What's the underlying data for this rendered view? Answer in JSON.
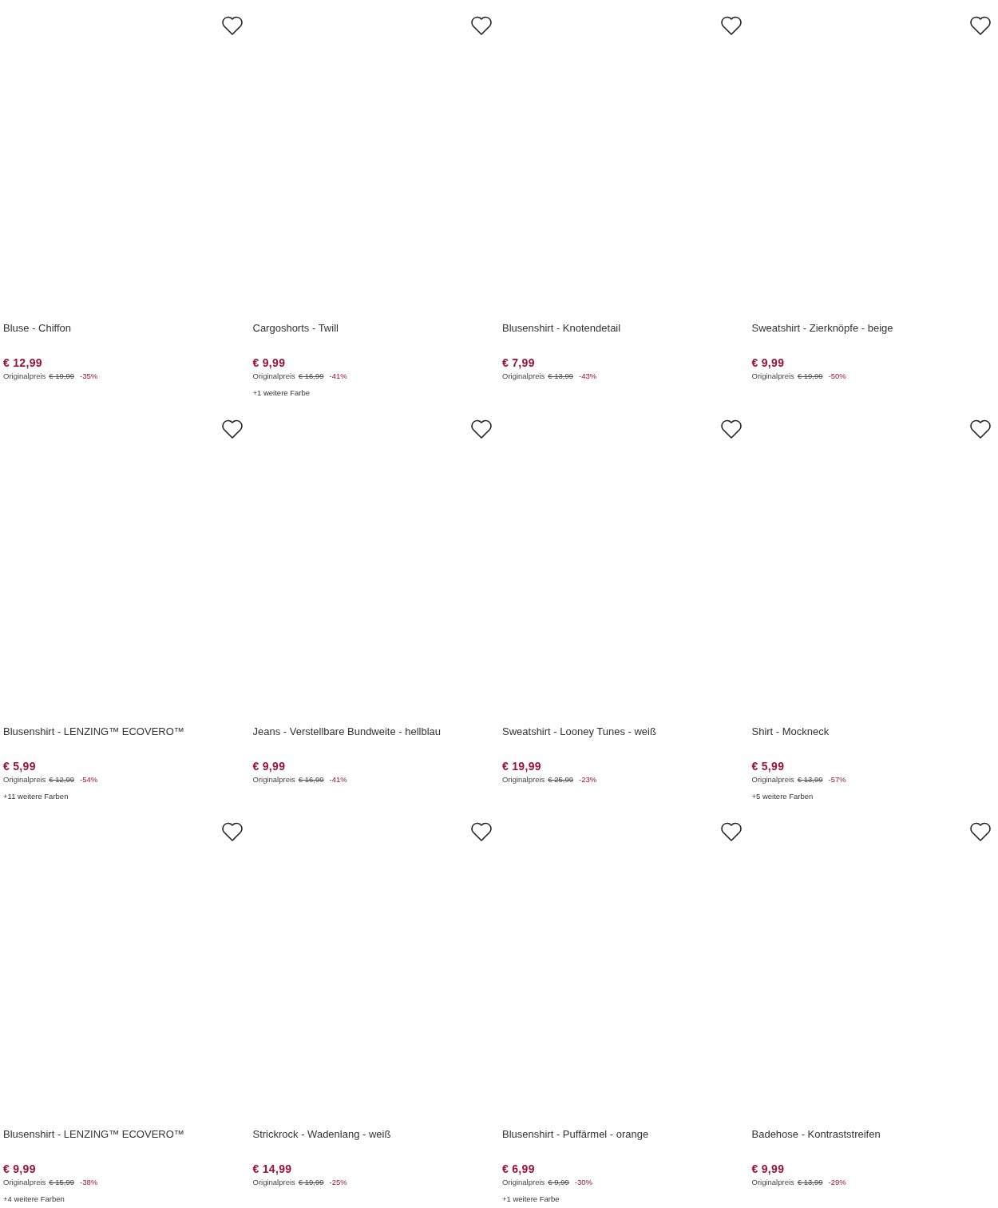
{
  "products": [
    {
      "title": "Bluse - Chiffon",
      "price": "€ 12,99",
      "original_label": "Originalpreis",
      "original_price": "€ 19,99",
      "discount": "-35%",
      "favorite": false
    },
    {
      "title": "Cargoshorts - Twill",
      "price": "€ 9,99",
      "original_label": "Originalpreis",
      "original_price": "€ 16,99",
      "discount": "-41%",
      "more_colors": "+1 weitere Farbe",
      "favorite": false
    },
    {
      "title": "Blusenshirt - Knotendetail",
      "price": "€ 7,99",
      "original_label": "Originalpreis",
      "original_price": "€ 13,99",
      "discount": "-43%",
      "favorite": false
    },
    {
      "title": "Sweatshirt - Zierknöpfe - beige",
      "price": "€ 9,99",
      "original_label": "Originalpreis",
      "original_price": "€ 19,99",
      "discount": "-50%",
      "favorite": false
    },
    {
      "title": "Blusenshirt - LENZING™ ECOVERO™",
      "price": "€ 5,99",
      "original_label": "Originalpreis",
      "original_price": "€ 12,99",
      "discount": "-54%",
      "more_colors": "+11 weitere Farben",
      "favorite": false
    },
    {
      "title": "Jeans - Verstellbare Bundweite - hellblau",
      "price": "€ 9,99",
      "original_label": "Originalpreis",
      "original_price": "€ 16,99",
      "discount": "-41%",
      "favorite": false
    },
    {
      "title": "Sweatshirt - Looney Tunes - weiß",
      "price": "€ 19,99",
      "original_label": "Originalpreis",
      "original_price": "€ 25,99",
      "discount": "-23%",
      "favorite": false
    },
    {
      "title": "Shirt - Mockneck",
      "price": "€ 5,99",
      "original_label": "Originalpreis",
      "original_price": "€ 13,99",
      "discount": "-57%",
      "more_colors": "+5 weitere Farben",
      "favorite": false
    },
    {
      "title": "Blusenshirt - LENZING™ ECOVERO™",
      "price": "€ 9,99",
      "original_label": "Originalpreis",
      "original_price": "€ 15,99",
      "discount": "-38%",
      "more_colors": "+4 weitere Farben",
      "favorite": false
    },
    {
      "title": "Strickrock - Wadenlang - weiß",
      "price": "€ 14,99",
      "original_label": "Originalpreis",
      "original_price": "€ 19,99",
      "discount": "-25%",
      "favorite": false
    },
    {
      "title": "Blusenshirt - Puffärmel - orange",
      "price": "€ 6,99",
      "original_label": "Originalpreis",
      "original_price": "€ 9,99",
      "discount": "-30%",
      "more_colors": "+1 weitere Farbe",
      "favorite": false
    },
    {
      "title": "Badehose - Kontraststreifen",
      "price": "€ 9,99",
      "original_label": "Originalpreis",
      "original_price": "€ 13,99",
      "discount": "-29%",
      "favorite": false
    }
  ]
}
